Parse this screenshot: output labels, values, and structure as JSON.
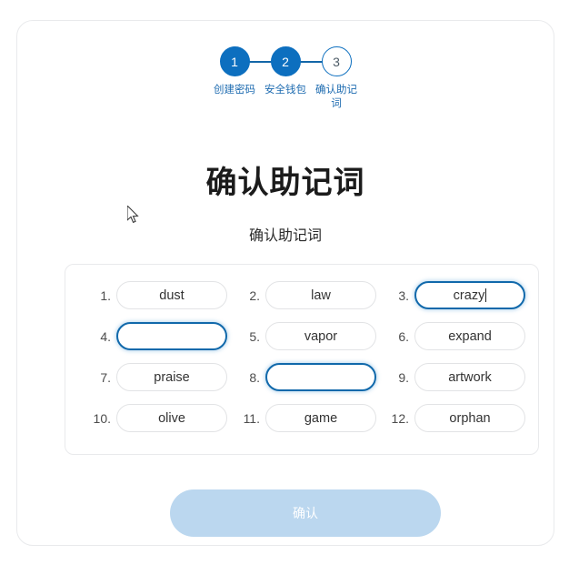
{
  "stepper": {
    "steps": [
      {
        "number": "1",
        "label": "创建密码",
        "state": "done"
      },
      {
        "number": "2",
        "label": "安全钱包",
        "state": "done"
      },
      {
        "number": "3",
        "label": "确认助记词",
        "state": "todo"
      }
    ],
    "accent_color": "#0d6fbf",
    "label_color": "#1d6bb0"
  },
  "page": {
    "title": "确认助记词",
    "subtitle": "确认助记词"
  },
  "words": [
    {
      "num": "1.",
      "value": "dust",
      "focused": false,
      "caret": false
    },
    {
      "num": "2.",
      "value": "law",
      "focused": false,
      "caret": false
    },
    {
      "num": "3.",
      "value": "crazy",
      "focused": true,
      "caret": true
    },
    {
      "num": "4.",
      "value": "",
      "focused": true,
      "caret": false
    },
    {
      "num": "5.",
      "value": "vapor",
      "focused": false,
      "caret": false
    },
    {
      "num": "6.",
      "value": "expand",
      "focused": false,
      "caret": false
    },
    {
      "num": "7.",
      "value": "praise",
      "focused": false,
      "caret": false
    },
    {
      "num": "8.",
      "value": "",
      "focused": true,
      "caret": false
    },
    {
      "num": "9.",
      "value": "artwork",
      "focused": false,
      "caret": false
    },
    {
      "num": "10.",
      "value": "olive",
      "focused": false,
      "caret": false
    },
    {
      "num": "11.",
      "value": "game",
      "focused": false,
      "caret": false
    },
    {
      "num": "12.",
      "value": "orphan",
      "focused": false,
      "caret": false
    }
  ],
  "confirm_button": {
    "label": "确认",
    "disabled": true,
    "background": "#bbd7ef",
    "text_color": "#ffffff"
  }
}
